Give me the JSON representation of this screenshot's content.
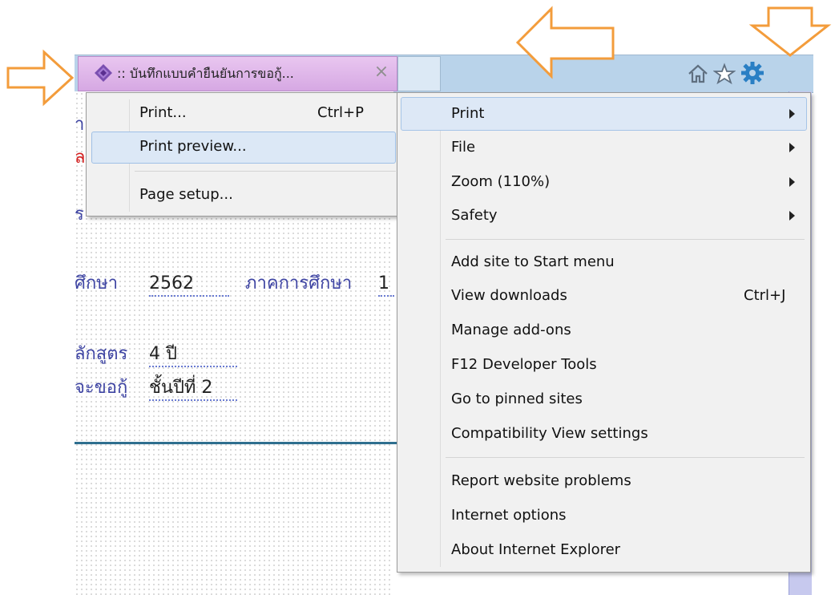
{
  "tab": {
    "title": ":: บันทึกแบบคำยืนยันการขอกู้...",
    "close": "×"
  },
  "toolbar": {
    "home_icon": "home-icon",
    "favorites_icon": "star-icon",
    "tools_icon": "gear-icon"
  },
  "page": {
    "line1_label": "ศึกษา",
    "line1_value": "2562",
    "line1_label2": "ภาคการศึกษา",
    "line1_value2": "1",
    "line2_label": "ลักสูตร",
    "line2_value": "4  ปี",
    "line3_label": "จะขอกู้",
    "line3_value": "ชั้นปีที่  2",
    "fragment_a": "า",
    "fragment_b": "ล",
    "fragment_c": "ร"
  },
  "print_submenu": {
    "items": [
      {
        "label": "Print...",
        "shortcut": "Ctrl+P"
      },
      {
        "label": "Print preview..."
      },
      {
        "label": "Page setup..."
      }
    ]
  },
  "tools_menu": {
    "items": [
      {
        "label": "Print",
        "has_submenu": true
      },
      {
        "label": "File",
        "has_submenu": true
      },
      {
        "label": "Zoom (110%)",
        "has_submenu": true
      },
      {
        "label": "Safety",
        "has_submenu": true
      },
      {
        "label": "Add site to Start menu"
      },
      {
        "label": "View downloads",
        "shortcut": "Ctrl+J"
      },
      {
        "label": "Manage add-ons"
      },
      {
        "label": "F12 Developer Tools"
      },
      {
        "label": "Go to pinned sites"
      },
      {
        "label": "Compatibility View settings"
      },
      {
        "label": "Report website problems"
      },
      {
        "label": "Internet options"
      },
      {
        "label": "About Internet Explorer"
      }
    ]
  },
  "colors": {
    "callout_orange": "#f39c3b",
    "tab_purple": "#d6a8e3",
    "toolbar_blue": "#b9d3ea",
    "gear_blue": "#2a7fc4"
  }
}
